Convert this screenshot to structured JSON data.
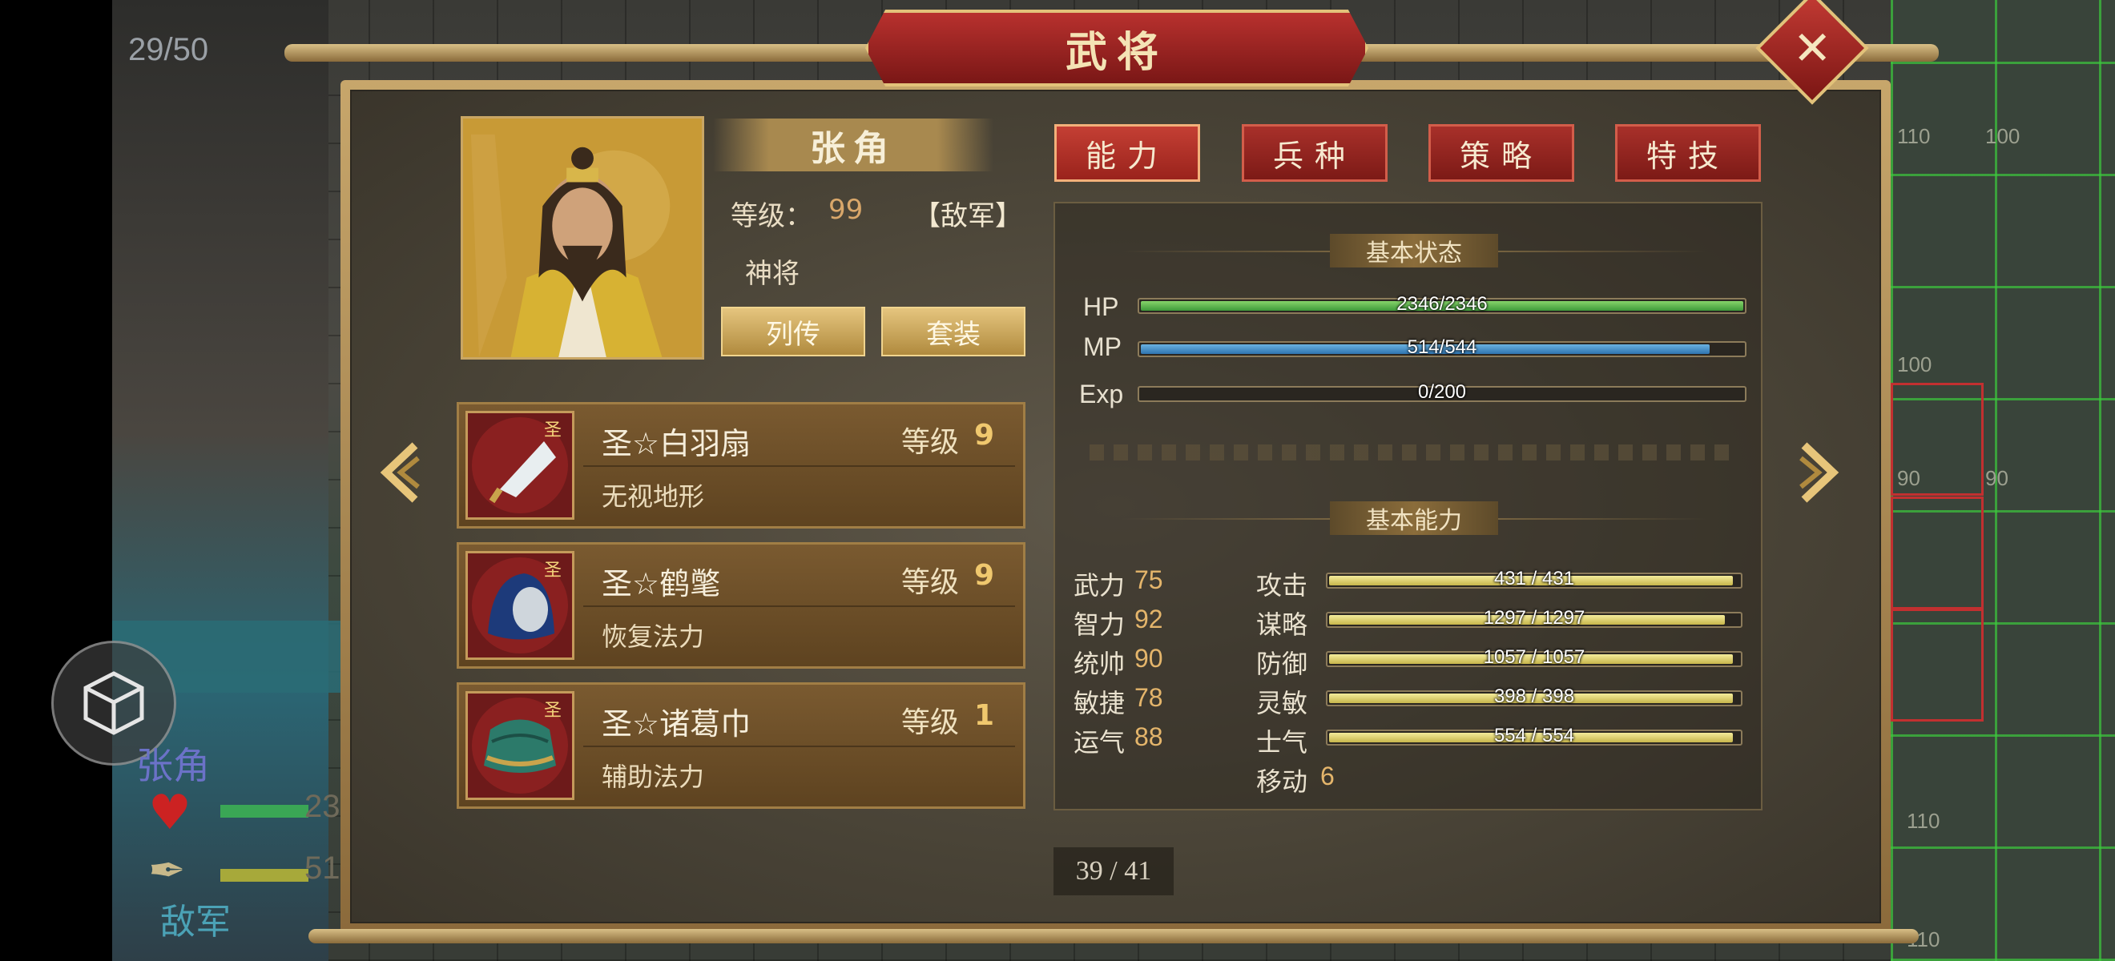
{
  "hud": {
    "turn_counter": "29/50",
    "unit_name": "张角",
    "unit_side": "敌军",
    "unit_hp_partial": "23",
    "unit_mp_partial": "51",
    "grid_numbers": [
      "110",
      "100",
      "100",
      "90",
      "90",
      "110",
      "110"
    ]
  },
  "dialog": {
    "title": "武将",
    "close_icon": "close-icon"
  },
  "general": {
    "name": "张角",
    "level_label": "等级：",
    "level_value": "99",
    "faction": "【敌军】",
    "rank": "神将",
    "biography_button": "列传",
    "set_button": "套装"
  },
  "equipment": [
    {
      "name": "圣☆白羽扇",
      "level_label": "等级",
      "level": "9",
      "effect": "无视地形",
      "icon": "feather-fan-icon"
    },
    {
      "name": "圣☆鹤氅",
      "level_label": "等级",
      "level": "9",
      "effect": "恢复法力",
      "icon": "crane-cloak-icon"
    },
    {
      "name": "圣☆诸葛巾",
      "level_label": "等级",
      "level": "1",
      "effect": "辅助法力",
      "icon": "zhuge-hat-icon"
    }
  ],
  "tabs": [
    {
      "label": "能力",
      "active": true
    },
    {
      "label": "兵种",
      "active": false
    },
    {
      "label": "策略",
      "active": false
    },
    {
      "label": "特技",
      "active": false
    }
  ],
  "basic_status": {
    "title": "基本状态",
    "hp": {
      "label": "HP",
      "current": 2346,
      "max": 2346,
      "text": "2346/2346"
    },
    "mp": {
      "label": "MP",
      "current": 514,
      "max": 544,
      "text": "514/544"
    },
    "exp": {
      "label": "Exp",
      "current": 0,
      "max": 200,
      "text": "0/200"
    }
  },
  "basic_ability": {
    "title": "基本能力",
    "attributes": [
      {
        "name": "武力",
        "value": "75"
      },
      {
        "name": "智力",
        "value": "92"
      },
      {
        "name": "统帅",
        "value": "90"
      },
      {
        "name": "敏捷",
        "value": "78"
      },
      {
        "name": "运气",
        "value": "88"
      }
    ],
    "stats": [
      {
        "name": "攻击",
        "text": "431 / 431",
        "fill": 0.985
      },
      {
        "name": "谋略",
        "text": "1297 / 1297",
        "fill": 0.965
      },
      {
        "name": "防御",
        "text": "1057 / 1057",
        "fill": 0.985
      },
      {
        "name": "灵敏",
        "text": "398 / 398",
        "fill": 0.985
      },
      {
        "name": "士气",
        "text": "554 / 554",
        "fill": 0.985
      }
    ],
    "move_label": "移动",
    "move_value": "6"
  },
  "pagination": {
    "text": "39 / 41"
  },
  "colors": {
    "accent_red": "#a8302a",
    "gold": "#c9a664",
    "hp_green": "#3e9a3a",
    "mp_blue": "#2f74b0"
  }
}
